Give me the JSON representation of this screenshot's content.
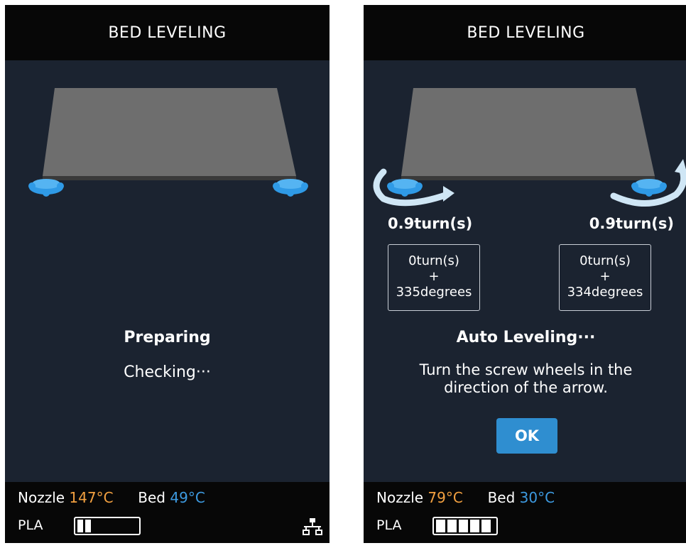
{
  "left_screen": {
    "title": "BED LEVELING",
    "status_title": "Preparing",
    "status_sub": "Checking···",
    "footer": {
      "nozzle_label": "Nozzle",
      "nozzle_temp": "147°C",
      "bed_label": "Bed",
      "bed_temp": "49°C",
      "material": "PLA",
      "battery_bars_filled": 2,
      "network_icon": "network-icon"
    }
  },
  "right_screen": {
    "title": "BED LEVELING",
    "left_turns": "0.9turn(s)",
    "right_turns": "0.9turn(s)",
    "left_box": {
      "line1": "0turn(s)",
      "line2": "+",
      "line3": "335degrees"
    },
    "right_box": {
      "line1": "0turn(s)",
      "line2": "+",
      "line3": "334degrees"
    },
    "status_title": "Auto Leveling···",
    "instruction_line1": "Turn the screw wheels in the",
    "instruction_line2": "direction of the arrow.",
    "ok_label": "OK",
    "footer": {
      "nozzle_label": "Nozzle",
      "nozzle_temp": "79°C",
      "bed_label": "Bed",
      "bed_temp": "30°C",
      "material": "PLA",
      "battery_bars_filled": 5
    }
  },
  "colors": {
    "screen_bg": "#1b2330",
    "header_bg": "#070707",
    "nozzle_temp": "#f2a040",
    "bed_temp": "#3d9ae0",
    "knob": "#2f9ae6",
    "ok_button": "#2f8ed0"
  }
}
